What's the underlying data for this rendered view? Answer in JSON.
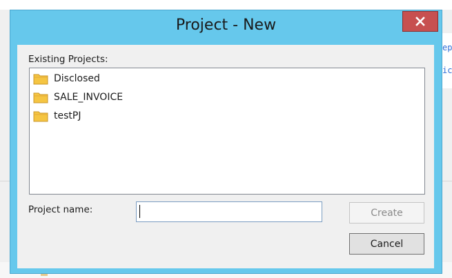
{
  "dialog": {
    "title": "Project - New",
    "close_button": "close",
    "existing_label": "Existing Projects:",
    "projects": [
      {
        "label": "Disclosed",
        "icon": "folder-icon"
      },
      {
        "label": "SALE_INVOICE",
        "icon": "folder-icon"
      },
      {
        "label": "testPJ",
        "icon": "folder-icon"
      }
    ],
    "name_label": "Project name:",
    "name_value": "",
    "create_label": "Create",
    "create_enabled": false,
    "cancel_label": "Cancel"
  },
  "background": {
    "code_line_1": "ep",
    "code_line_2": "ic"
  },
  "colors": {
    "titlebar": "#66c8ec",
    "close_button": "#c75050",
    "folder": "#f5c542"
  }
}
